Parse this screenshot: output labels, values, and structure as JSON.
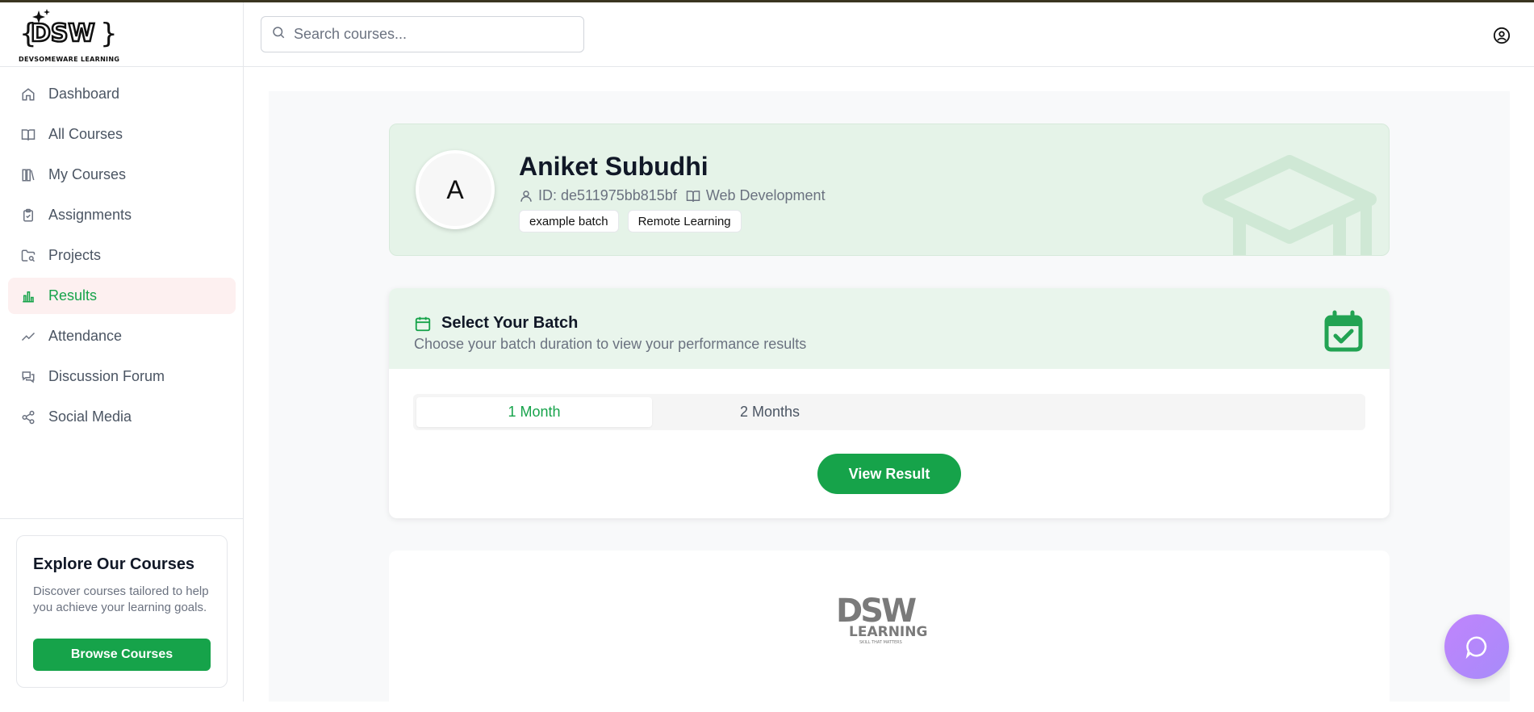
{
  "brand": {
    "logo_text": "DSW",
    "caption": "DEVSOMEWARE LEARNING"
  },
  "search": {
    "placeholder": "Search courses..."
  },
  "sidebar": {
    "items": [
      {
        "label": "Dashboard",
        "icon": "home-icon"
      },
      {
        "label": "All Courses",
        "icon": "book-open-icon"
      },
      {
        "label": "My Courses",
        "icon": "library-icon"
      },
      {
        "label": "Assignments",
        "icon": "clipboard-check-icon"
      },
      {
        "label": "Projects",
        "icon": "folder-search-icon"
      },
      {
        "label": "Results",
        "icon": "bar-chart-icon",
        "active": true
      },
      {
        "label": "Attendance",
        "icon": "trending-up-icon"
      },
      {
        "label": "Discussion Forum",
        "icon": "messages-icon"
      },
      {
        "label": "Social Media",
        "icon": "share-icon"
      }
    ],
    "promo": {
      "title": "Explore Our Courses",
      "text": "Discover courses tailored to help you achieve your learning goals.",
      "button": "Browse Courses"
    }
  },
  "profile": {
    "initial": "A",
    "name": "Aniket Subudhi",
    "id_text": "ID: de511975bb815bf",
    "course": "Web Development",
    "tags": [
      "example batch",
      "Remote Learning"
    ]
  },
  "batch": {
    "title": "Select Your Batch",
    "subtitle": "Choose your batch duration to view your performance results",
    "tabs": [
      "1 Month",
      "2 Months"
    ],
    "active_tab": 0,
    "button": "View Result"
  },
  "result_logo": {
    "big": "DSW",
    "word": "LEARNING",
    "tagline": "SKILL THAT MATTERS"
  },
  "colors": {
    "accent": "#16a34a",
    "profile_bg": "#e5f3e8",
    "active_nav_bg": "#fdf0f0",
    "fab": "#a78bfa"
  }
}
